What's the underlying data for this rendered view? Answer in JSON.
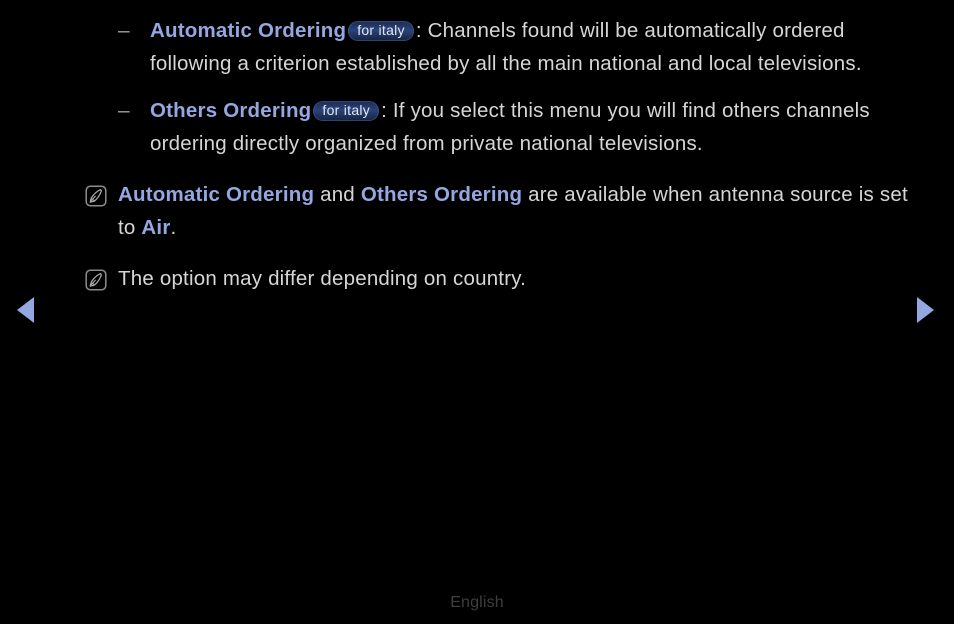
{
  "screen": {
    "background_color": "#000000",
    "body_text_color": "#d6d6d6",
    "accent_color": "#93a7e0",
    "badge_text_color": "#e3e6ef"
  },
  "bullets": [
    {
      "marker": "–",
      "term": "Automatic Ordering",
      "badge": "for italy",
      "separator": ": ",
      "text": "Channels found will be automatically ordered following a criterion established by all the main national and local televisions."
    },
    {
      "marker": "–",
      "term": "Others Ordering",
      "badge": "for italy",
      "separator": ": ",
      "text": "If you select this menu you will find others channels ordering directly organized from private national televisions."
    }
  ],
  "notes": [
    {
      "icon": "note-pencil-icon",
      "term_1": "Automatic Ordering",
      "mid_text": " and ",
      "term_2": "Others Ordering",
      "tail_text": " are available when antenna source is set to ",
      "term_3": "Air",
      "end_text": "."
    },
    {
      "icon": "note-pencil-icon",
      "text": "The option may differ depending on country."
    }
  ],
  "navigation": {
    "previous_label": "◀",
    "next_label": "▶",
    "previous_name": "previous-page-arrow",
    "next_name": "next-page-arrow"
  },
  "footer": {
    "language": "English"
  }
}
